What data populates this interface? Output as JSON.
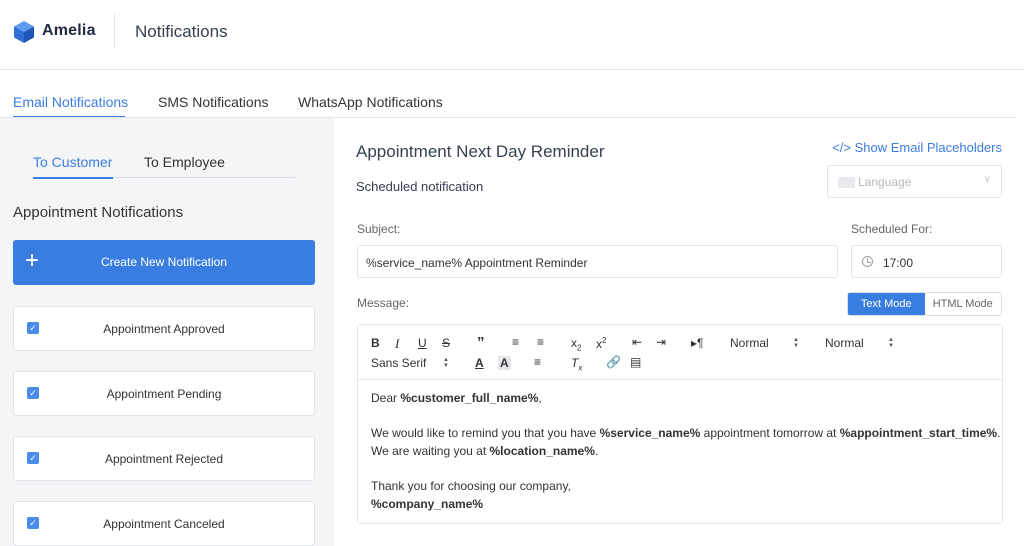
{
  "app": {
    "brand": "Amelia",
    "page_title": "Notifications"
  },
  "main_tabs": [
    {
      "label": "Email Notifications",
      "active": true
    },
    {
      "label": "SMS Notifications",
      "active": false
    },
    {
      "label": "WhatsApp Notifications",
      "active": false
    }
  ],
  "sub_tabs": [
    {
      "label": "To Customer",
      "active": true
    },
    {
      "label": "To Employee",
      "active": false
    }
  ],
  "left": {
    "section_title": "Appointment Notifications",
    "create_label": "Create New Notification",
    "notifications": [
      {
        "label": "Appointment Approved",
        "checked": true
      },
      {
        "label": "Appointment Pending",
        "checked": true
      },
      {
        "label": "Appointment Rejected",
        "checked": true
      },
      {
        "label": "Appointment Canceled",
        "checked": true
      }
    ]
  },
  "detail": {
    "title": "Appointment Next Day Reminder",
    "placeholders_link": "</> Show Email Placeholders",
    "subtitle": "Scheduled notification",
    "language_placeholder": "Language",
    "subject_label": "Subject:",
    "subject_value": "%service_name% Appointment Reminder",
    "scheduled_label": "Scheduled For:",
    "scheduled_value": "17:00",
    "message_label": "Message:",
    "modes": [
      {
        "label": "Text Mode",
        "active": true
      },
      {
        "label": "HTML Mode",
        "active": false
      }
    ],
    "toolbar": {
      "heading_select": "Normal",
      "size_select": "Normal",
      "font_select": "Sans Serif"
    },
    "message": {
      "l1_a": "Dear ",
      "l1_b": "%customer_full_name%",
      "l1_c": ",",
      "l2_a": "We would like to remind you that you have ",
      "l2_b": "%service_name%",
      "l2_c": " appointment tomorrow at ",
      "l2_d": "%appointment_start_time%",
      "l2_e": ".",
      "l3_a": "We are waiting you at ",
      "l3_b": "%location_name%",
      "l3_c": ".",
      "l4": "Thank you for choosing our company,",
      "l5": "%company_name%"
    }
  },
  "colors": {
    "accent": "#3a7de0",
    "background": "#f4f5f7",
    "panel": "#ffffff"
  }
}
